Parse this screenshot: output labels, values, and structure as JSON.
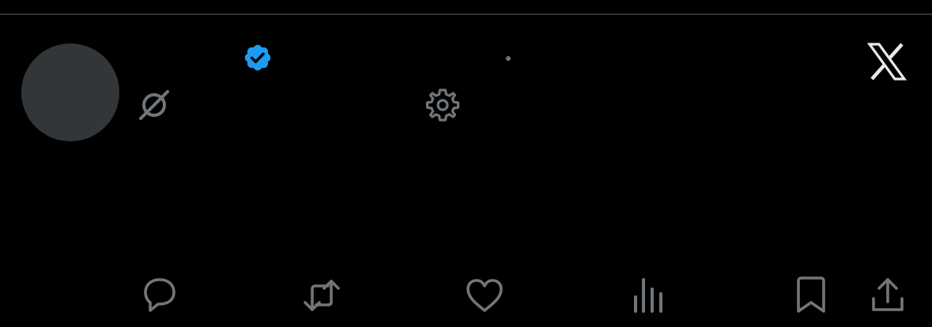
{
  "colors": {
    "background": "#000000",
    "divider": "#2f3336",
    "avatar_placeholder": "#333639",
    "icon_gray": "#71767b",
    "verified_blue": "#1d9bf0",
    "logo_white": "#e7e9ea"
  },
  "post_header": {
    "avatar": "avatar-placeholder",
    "verified_badge_icon": "verified-badge-icon",
    "separator": "dot-separator",
    "brand_logo_icon": "x-logo-icon"
  },
  "post_meta": {
    "restriction_icon": "not-allowed-icon",
    "settings_icon": "gear-icon"
  },
  "action_bar": {
    "items": [
      {
        "name": "reply-button",
        "icon": "speech-bubble-icon"
      },
      {
        "name": "repost-button",
        "icon": "repost-arrows-icon"
      },
      {
        "name": "like-button",
        "icon": "heart-icon"
      },
      {
        "name": "views-button",
        "icon": "bar-chart-icon"
      },
      {
        "name": "bookmark-button",
        "icon": "bookmark-icon"
      },
      {
        "name": "share-button",
        "icon": "share-upload-icon"
      }
    ]
  }
}
